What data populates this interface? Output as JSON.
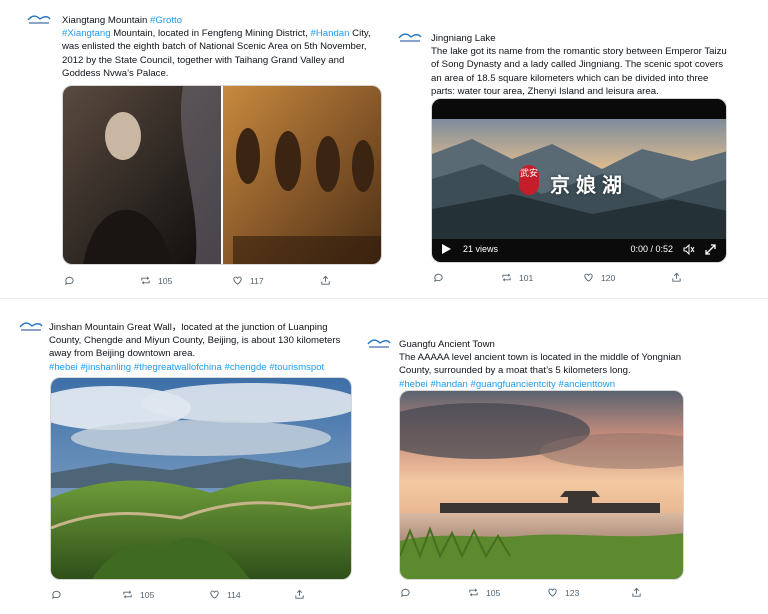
{
  "tweets": [
    {
      "title": "Xiangtang Mountain",
      "title_tag": "#Grotto",
      "line_tag": "#Xiangtang",
      "line_text": " Mountain, located in Fengfeng Mining District, ",
      "line_tag2": "#Handan",
      "line_text2": " City, was enlisted the eighth batch of National Scenic Area on 5th November, 2012 by the State Council, together with Taihang Grand Valley and Goddess Nvwa’s Palace.",
      "stats": {
        "reply": "",
        "retweet": "105",
        "like": "117"
      }
    },
    {
      "title": "Jingniang Lake",
      "text": "The lake got its name from the romantic story between Emperor Taizu of Song Dynasty and a lady called Jingniang. The scenic spot covers an area of 18.5 square kilometers which can be divided into three parts: water tour area, Zhenyi Island and leisura area.",
      "video": {
        "views": "21 views",
        "time": "0:00 / 0:52",
        "seal": "武安",
        "overlay_title": "京娘湖"
      },
      "stats": {
        "reply": "",
        "retweet": "101",
        "like": "120"
      }
    },
    {
      "title": "Jinshan Mountain Great Wall",
      "text": "，located at the junction of Luanping County, Chengde and Miyun County, Beijing, is about 130 kilometers away from Beijing downtown area.",
      "tags": "#hebei #jinshanling #thegreatwallofchina #chengde #tourismspot",
      "stats": {
        "reply": "",
        "retweet": "105",
        "like": "114"
      }
    },
    {
      "title": "Guangfu Ancient Town",
      "text": "The AAAAA level ancient town is located in the middle of Yongnian County, surrounded by a moat that’s 5 kilometers long.",
      "tags": "#hebei #handan #guangfuancientcity #ancienttown",
      "stats": {
        "reply": "",
        "retweet": "105",
        "like": "123"
      }
    }
  ],
  "icons": [
    "avatar-logo",
    "reply-icon",
    "retweet-icon",
    "like-icon",
    "share-icon",
    "play-icon",
    "volume-icon",
    "fullscreen-icon"
  ],
  "colors": {
    "link": "#1d9bf0",
    "muted": "#536471",
    "seal": "#c41e2a"
  }
}
